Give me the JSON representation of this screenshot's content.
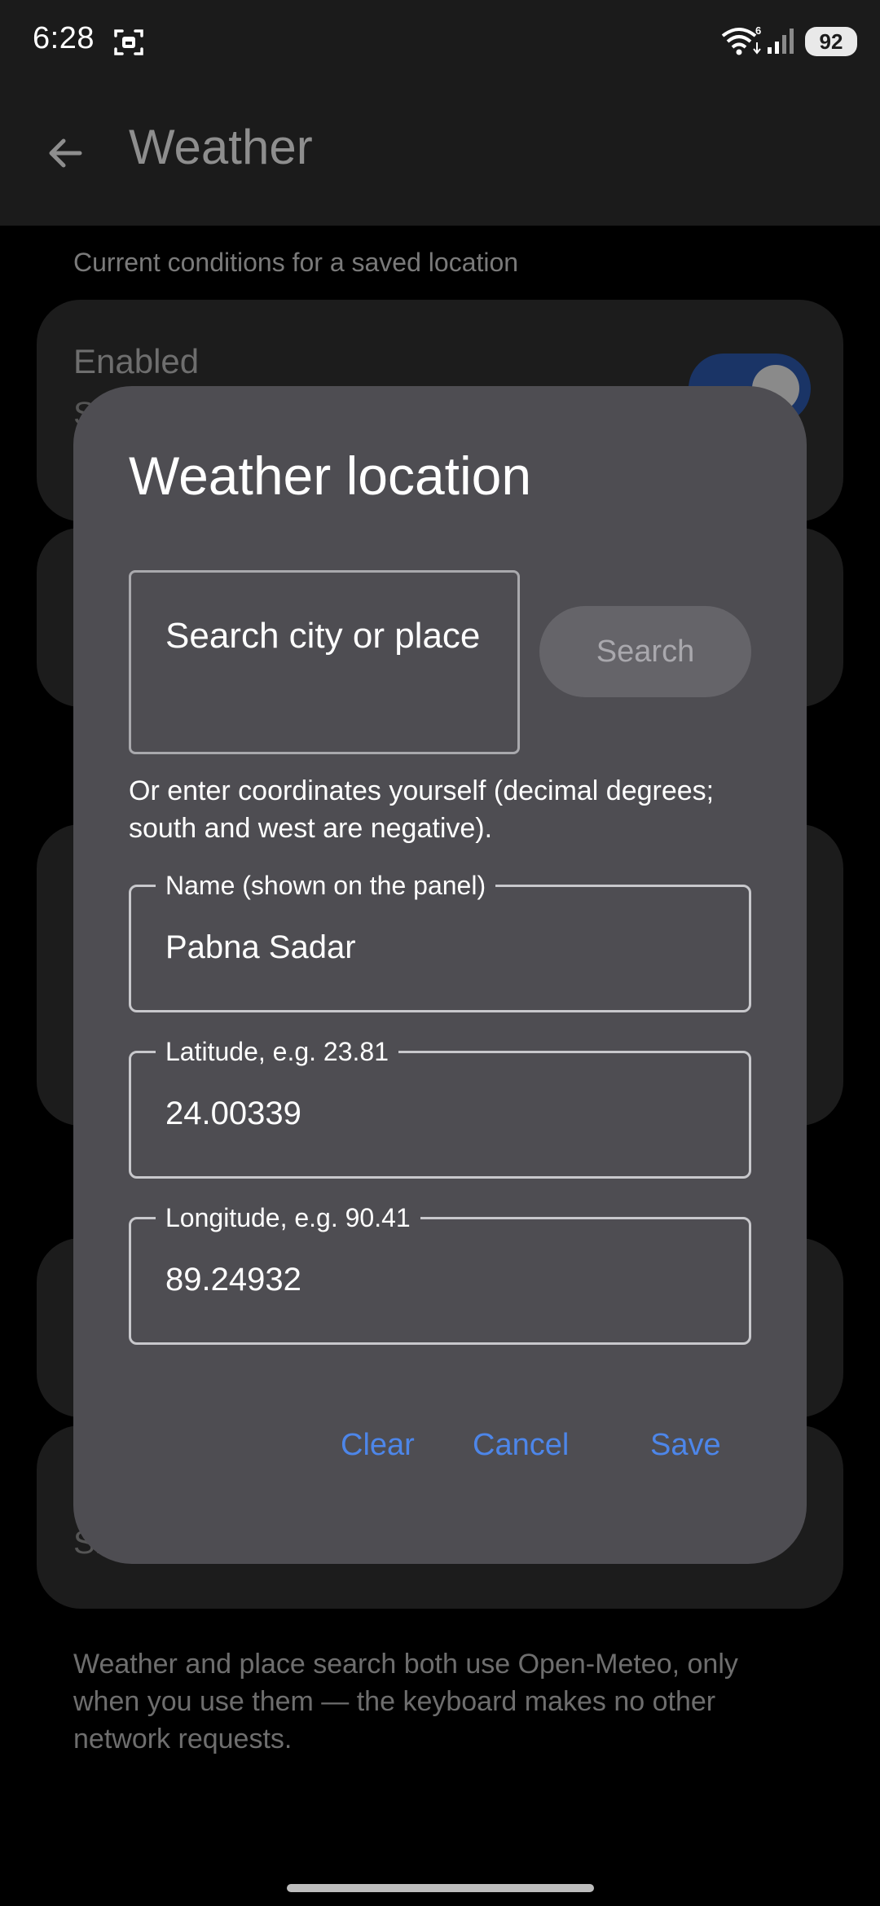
{
  "status_bar": {
    "time": "6:28",
    "wifi_badge": "6",
    "battery": "92",
    "icons": [
      "screen-record-icon",
      "wifi-icon",
      "signal-icon",
      "battery-icon"
    ]
  },
  "app_bar": {
    "title": "Weather",
    "back_icon": "arrow-left-icon"
  },
  "background": {
    "subtitle": "Current conditions for a saved location",
    "card_a": {
      "label": "Enabled",
      "fragment": "S",
      "toggle_on": true
    },
    "card_e": {
      "fragment": "Sh"
    },
    "footnote": "Weather and place search both use Open-Meteo, only when you use them — the keyboard makes no other network requests."
  },
  "dialog": {
    "title": "Weather location",
    "search": {
      "placeholder": "Search city or place",
      "button_label": "Search"
    },
    "hint": "Or enter coordinates yourself (decimal degrees; south and west are negative).",
    "fields": {
      "name": {
        "label": "Name (shown on the panel)",
        "value": "Pabna Sadar"
      },
      "latitude": {
        "label": "Latitude, e.g. 23.81",
        "value": "24.00339"
      },
      "longitude": {
        "label": "Longitude, e.g. 90.41",
        "value": "89.24932"
      }
    },
    "actions": {
      "clear": "Clear",
      "cancel": "Cancel",
      "save": "Save"
    }
  },
  "colors": {
    "dialog_bg": "#4e4d52",
    "accent": "#4d86e9",
    "app_bar_bg": "#1b1b1b",
    "screen_bg": "#000000"
  }
}
